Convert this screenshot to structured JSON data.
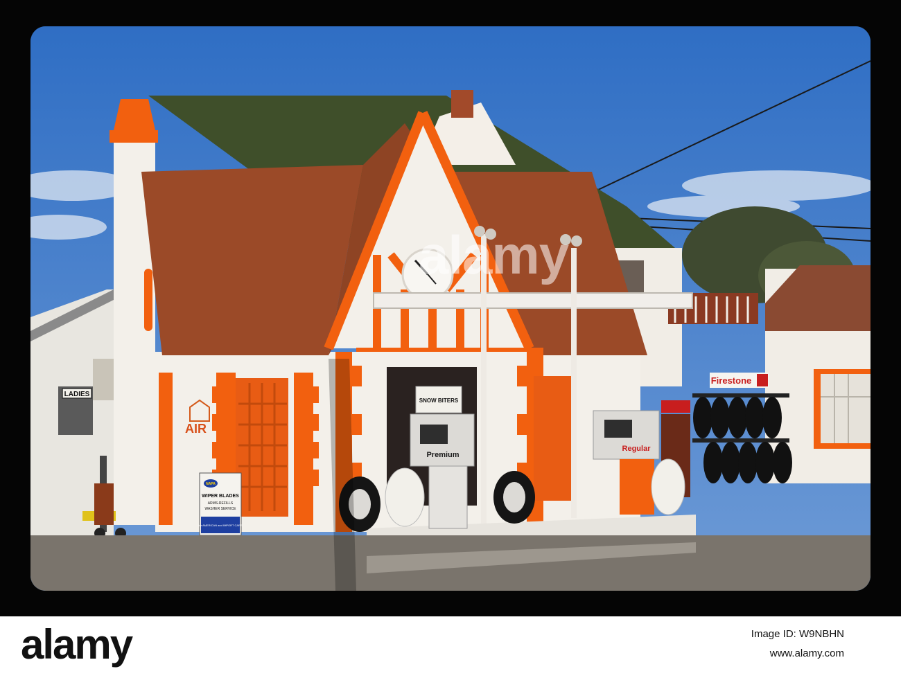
{
  "signs": {
    "ladies": "LADIES",
    "air": "AIR",
    "firestone": "Firestone",
    "premium": "Premium",
    "regular": "Regular",
    "snow_biters": "SNOW BITERS",
    "napa_title": "WIPER BLADES",
    "napa_line2": "ARMS-REFILLS",
    "napa_line3": "WASHER SERVICE",
    "napa_line4": "for AMERICAN and IMPORT CARS",
    "napa_brand": "NAPA"
  },
  "watermark": {
    "main": "alamy"
  },
  "footer": {
    "logo": "alamy",
    "image_id": "Image ID: W9NBHN",
    "url": "www.alamy.com"
  },
  "colors": {
    "sky": "#3a78c8",
    "orange_trim": "#f2600f",
    "roof": "#9b4a28",
    "green_roof": "#4a5a2e"
  }
}
